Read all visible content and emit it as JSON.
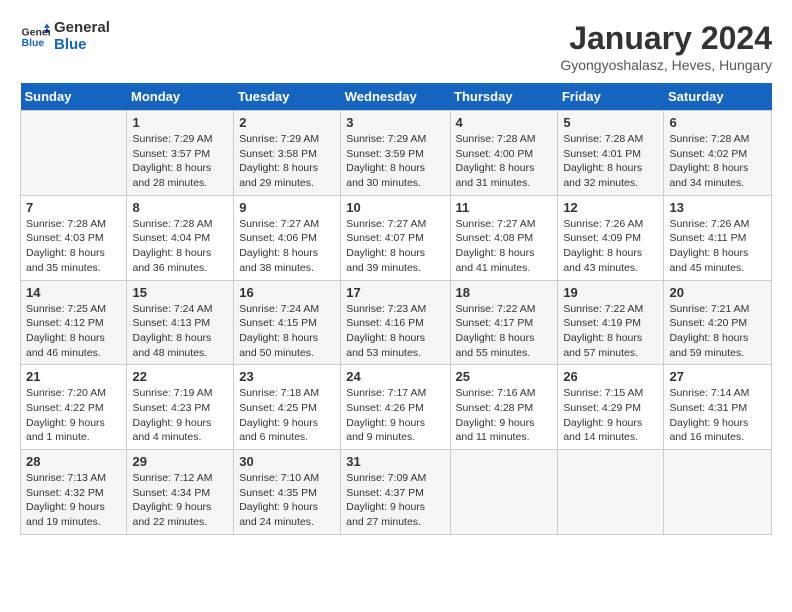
{
  "logo": {
    "line1": "General",
    "line2": "Blue"
  },
  "title": "January 2024",
  "subtitle": "Gyongyoshalasz, Heves, Hungary",
  "days_header": [
    "Sunday",
    "Monday",
    "Tuesday",
    "Wednesday",
    "Thursday",
    "Friday",
    "Saturday"
  ],
  "weeks": [
    [
      {
        "day": "",
        "info": ""
      },
      {
        "day": "1",
        "info": "Sunrise: 7:29 AM\nSunset: 3:57 PM\nDaylight: 8 hours\nand 28 minutes."
      },
      {
        "day": "2",
        "info": "Sunrise: 7:29 AM\nSunset: 3:58 PM\nDaylight: 8 hours\nand 29 minutes."
      },
      {
        "day": "3",
        "info": "Sunrise: 7:29 AM\nSunset: 3:59 PM\nDaylight: 8 hours\nand 30 minutes."
      },
      {
        "day": "4",
        "info": "Sunrise: 7:28 AM\nSunset: 4:00 PM\nDaylight: 8 hours\nand 31 minutes."
      },
      {
        "day": "5",
        "info": "Sunrise: 7:28 AM\nSunset: 4:01 PM\nDaylight: 8 hours\nand 32 minutes."
      },
      {
        "day": "6",
        "info": "Sunrise: 7:28 AM\nSunset: 4:02 PM\nDaylight: 8 hours\nand 34 minutes."
      }
    ],
    [
      {
        "day": "7",
        "info": "Sunrise: 7:28 AM\nSunset: 4:03 PM\nDaylight: 8 hours\nand 35 minutes."
      },
      {
        "day": "8",
        "info": "Sunrise: 7:28 AM\nSunset: 4:04 PM\nDaylight: 8 hours\nand 36 minutes."
      },
      {
        "day": "9",
        "info": "Sunrise: 7:27 AM\nSunset: 4:06 PM\nDaylight: 8 hours\nand 38 minutes."
      },
      {
        "day": "10",
        "info": "Sunrise: 7:27 AM\nSunset: 4:07 PM\nDaylight: 8 hours\nand 39 minutes."
      },
      {
        "day": "11",
        "info": "Sunrise: 7:27 AM\nSunset: 4:08 PM\nDaylight: 8 hours\nand 41 minutes."
      },
      {
        "day": "12",
        "info": "Sunrise: 7:26 AM\nSunset: 4:09 PM\nDaylight: 8 hours\nand 43 minutes."
      },
      {
        "day": "13",
        "info": "Sunrise: 7:26 AM\nSunset: 4:11 PM\nDaylight: 8 hours\nand 45 minutes."
      }
    ],
    [
      {
        "day": "14",
        "info": "Sunrise: 7:25 AM\nSunset: 4:12 PM\nDaylight: 8 hours\nand 46 minutes."
      },
      {
        "day": "15",
        "info": "Sunrise: 7:24 AM\nSunset: 4:13 PM\nDaylight: 8 hours\nand 48 minutes."
      },
      {
        "day": "16",
        "info": "Sunrise: 7:24 AM\nSunset: 4:15 PM\nDaylight: 8 hours\nand 50 minutes."
      },
      {
        "day": "17",
        "info": "Sunrise: 7:23 AM\nSunset: 4:16 PM\nDaylight: 8 hours\nand 53 minutes."
      },
      {
        "day": "18",
        "info": "Sunrise: 7:22 AM\nSunset: 4:17 PM\nDaylight: 8 hours\nand 55 minutes."
      },
      {
        "day": "19",
        "info": "Sunrise: 7:22 AM\nSunset: 4:19 PM\nDaylight: 8 hours\nand 57 minutes."
      },
      {
        "day": "20",
        "info": "Sunrise: 7:21 AM\nSunset: 4:20 PM\nDaylight: 8 hours\nand 59 minutes."
      }
    ],
    [
      {
        "day": "21",
        "info": "Sunrise: 7:20 AM\nSunset: 4:22 PM\nDaylight: 9 hours\nand 1 minute."
      },
      {
        "day": "22",
        "info": "Sunrise: 7:19 AM\nSunset: 4:23 PM\nDaylight: 9 hours\nand 4 minutes."
      },
      {
        "day": "23",
        "info": "Sunrise: 7:18 AM\nSunset: 4:25 PM\nDaylight: 9 hours\nand 6 minutes."
      },
      {
        "day": "24",
        "info": "Sunrise: 7:17 AM\nSunset: 4:26 PM\nDaylight: 9 hours\nand 9 minutes."
      },
      {
        "day": "25",
        "info": "Sunrise: 7:16 AM\nSunset: 4:28 PM\nDaylight: 9 hours\nand 11 minutes."
      },
      {
        "day": "26",
        "info": "Sunrise: 7:15 AM\nSunset: 4:29 PM\nDaylight: 9 hours\nand 14 minutes."
      },
      {
        "day": "27",
        "info": "Sunrise: 7:14 AM\nSunset: 4:31 PM\nDaylight: 9 hours\nand 16 minutes."
      }
    ],
    [
      {
        "day": "28",
        "info": "Sunrise: 7:13 AM\nSunset: 4:32 PM\nDaylight: 9 hours\nand 19 minutes."
      },
      {
        "day": "29",
        "info": "Sunrise: 7:12 AM\nSunset: 4:34 PM\nDaylight: 9 hours\nand 22 minutes."
      },
      {
        "day": "30",
        "info": "Sunrise: 7:10 AM\nSunset: 4:35 PM\nDaylight: 9 hours\nand 24 minutes."
      },
      {
        "day": "31",
        "info": "Sunrise: 7:09 AM\nSunset: 4:37 PM\nDaylight: 9 hours\nand 27 minutes."
      },
      {
        "day": "",
        "info": ""
      },
      {
        "day": "",
        "info": ""
      },
      {
        "day": "",
        "info": ""
      }
    ]
  ]
}
